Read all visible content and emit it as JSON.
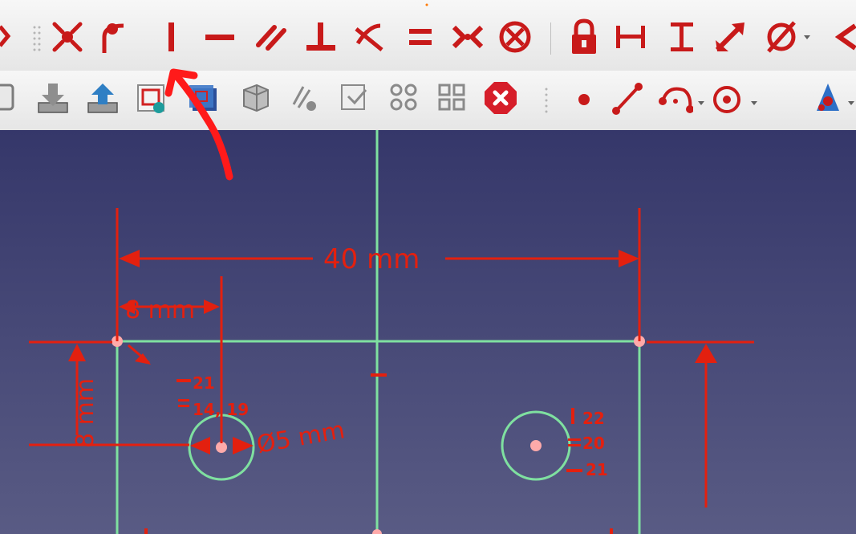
{
  "colors": {
    "toolbar_bg": "#ececec",
    "icon_red": "#c81a1a",
    "viewport_top": "#35376a",
    "viewport_bottom": "#595b84",
    "geometry_green": "#7fe0a0",
    "constraint_red": "#e3200f",
    "annotation_red": "#ff1a1a"
  },
  "sketcher_constraints_toolbar": {
    "icons": [
      "constrain-coincident-icon",
      "constrain-point-on-object-icon",
      "constrain-vertical-icon",
      "constrain-horizontal-icon",
      "constrain-parallel-icon",
      "constrain-perpendicular-icon",
      "constrain-tangent-icon",
      "constrain-equal-icon",
      "constrain-symmetric-icon",
      "constrain-block-icon",
      "constrain-lock-icon",
      "constrain-horizontal-distance-icon",
      "constrain-vertical-distance-icon",
      "constrain-distance-icon",
      "constrain-diameter-icon",
      "constrain-angle-icon"
    ]
  },
  "sketcher_geometry_toolbar": {
    "icons": [
      "view-sketch-icon",
      "import-icon",
      "export-icon",
      "leave-sketch-icon",
      "view-section-icon",
      "validate-sketch-icon",
      "map-sketch-icon",
      "merge-sketch-icon",
      "mirror-sketch-icon",
      "reorient-sketch-icon",
      "close-sketch-icon",
      "create-point-icon",
      "create-line-icon",
      "create-arc-icon",
      "create-circle-icon",
      "create-conic-icon"
    ]
  },
  "viewport": {
    "dimensions": {
      "width_40": "40 mm",
      "offset_8": "8 mm",
      "height_8": "8 mm",
      "diameter_5": "Ø5 mm"
    },
    "left_hole_constraints": {
      "horizontal_label": "21",
      "equal_label": "14, 19"
    },
    "right_hole_constraints": {
      "vertical_label": "22",
      "equal_label": "20",
      "horizontal_label": "21"
    }
  }
}
